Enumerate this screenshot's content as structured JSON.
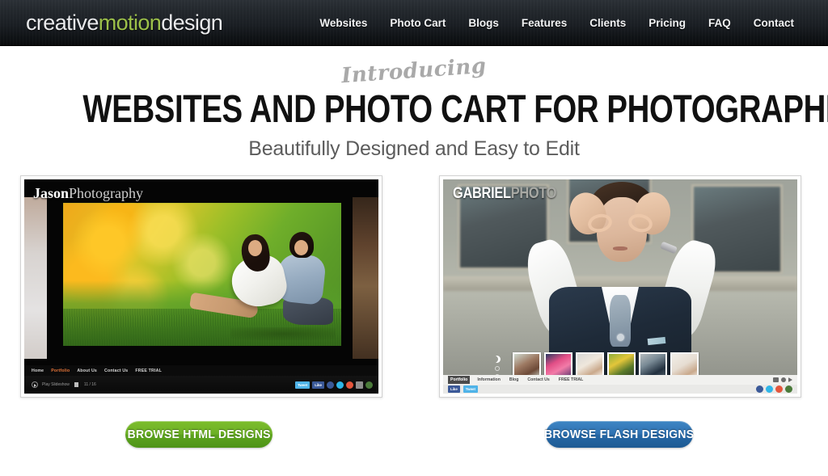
{
  "header": {
    "logo": {
      "part1": "creative",
      "part2": "motion",
      "part3": "design",
      "accent_color": "#9dc14a"
    },
    "nav": [
      {
        "label": "Websites"
      },
      {
        "label": "Photo Cart"
      },
      {
        "label": "Blogs"
      },
      {
        "label": "Features"
      },
      {
        "label": "Clients"
      },
      {
        "label": "Pricing"
      },
      {
        "label": "FAQ"
      },
      {
        "label": "Contact"
      }
    ]
  },
  "hero": {
    "eyebrow": "Introducing",
    "headline": "WEBSITES AND PHOTO CART FOR PHOTOGRAPHERS",
    "subhead": "Beautifully Designed and Easy to Edit"
  },
  "previews": {
    "html_demo": {
      "site_title_bold": "Jason",
      "site_title_light": "Photography",
      "nav": [
        {
          "label": "Home",
          "active": false
        },
        {
          "label": "Portfolio",
          "active": true
        },
        {
          "label": "About Us",
          "active": false
        },
        {
          "label": "Contact Us",
          "active": false
        },
        {
          "label": "FREE TRIAL",
          "active": false
        }
      ],
      "player": {
        "play_label": "Play Slideshow",
        "counter": "11 / 16"
      },
      "social": {
        "tweet_label": "Tweet",
        "like_label": "Like",
        "icons": [
          "facebook-icon",
          "twitter-icon",
          "google-plus-icon",
          "flickr-icon",
          "rss-icon"
        ]
      }
    },
    "flash_demo": {
      "site_title_bold": "GABRIEL",
      "site_title_light": "PHOTO",
      "nav": [
        {
          "label": "Portfolio",
          "active": true
        },
        {
          "label": "Information",
          "active": false
        },
        {
          "label": "Blog",
          "active": false
        },
        {
          "label": "Contact Us",
          "active": false
        },
        {
          "label": "FREE TRIAL",
          "active": false
        }
      ],
      "social": {
        "like_label": "Like",
        "tweet_label": "Tweet",
        "icons": [
          "facebook-icon",
          "twitter-icon",
          "google-plus-icon",
          "rss-icon"
        ]
      },
      "thumbnail_count": 6
    }
  },
  "cta": {
    "html_button": {
      "label": "BROWSE HTML DESIGNS",
      "color": "#66ab22"
    },
    "flash_button": {
      "label": "BROWSE FLASH DESIGNS",
      "color": "#2a6fae"
    }
  }
}
